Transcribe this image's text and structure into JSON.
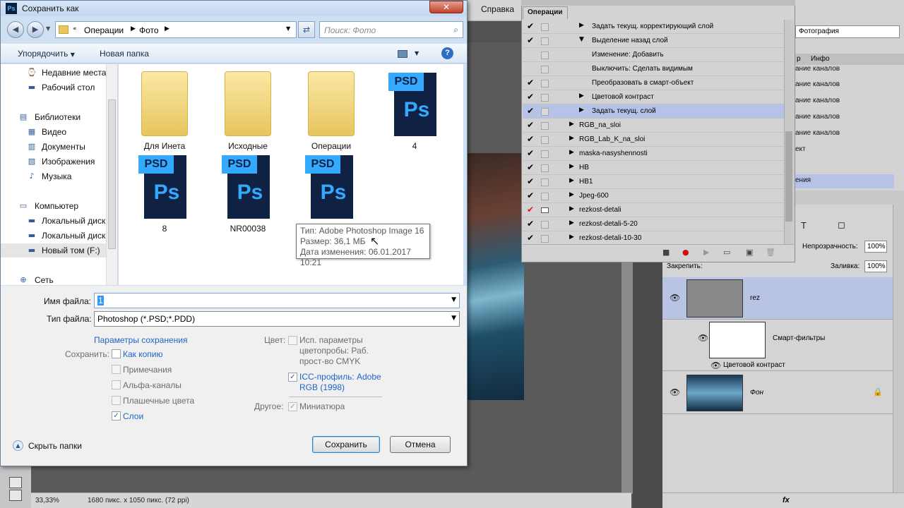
{
  "photoshop": {
    "menu_help": "Справка",
    "window_buttons": [
      "–",
      "❐",
      "✕"
    ],
    "status": {
      "zoom": "33,33%",
      "dimensions": "1680 пикс. x 1050 пикс. (72 ppi)"
    },
    "history_dropdown": "Фотография",
    "info_tabs": [
      "р",
      "Инфо"
    ],
    "history_items": [
      "ание каналов",
      "ание каналов",
      "ание каналов",
      "ание каналов",
      "ание каналов",
      "ект",
      "",
      "ения"
    ],
    "layers": {
      "opacity_label": "Непрозрачность:",
      "opacity_value": "100%",
      "lock_label": "Закрепить:",
      "fill_label": "Заливка:",
      "fill_value": "100%",
      "layer_rez": "rez",
      "smart_filters": "Смарт-фильтры",
      "color_contrast": "Цветовой контраст",
      "layer_fon": "Фон"
    }
  },
  "actions_panel": {
    "tab": "Операции",
    "rows": [
      {
        "label": "Задать текущ. корректирующий слой",
        "indent": 2,
        "tri": "▶",
        "check": "✔"
      },
      {
        "label": "Выделение назад слой",
        "indent": 2,
        "tri": "▼",
        "check": "✔"
      },
      {
        "label": "Изменение: Добавить",
        "indent": 3,
        "tri": "",
        "check": ""
      },
      {
        "label": "Выключить: Сделать видимым",
        "indent": 3,
        "tri": "",
        "check": ""
      },
      {
        "label": "Преобразовать в смарт-объект",
        "indent": 2,
        "tri": "",
        "check": "✔"
      },
      {
        "label": "Цветовой контраст",
        "indent": 2,
        "tri": "▶",
        "check": "✔"
      },
      {
        "label": "Задать текущ. слой",
        "indent": 2,
        "tri": "▶",
        "check": "✔"
      },
      {
        "label": "RGB_na_sloi",
        "indent": 1,
        "tri": "▶",
        "check": "✔"
      },
      {
        "label": "RGB_Lab_K_na_sloi",
        "indent": 1,
        "tri": "▶",
        "check": "✔"
      },
      {
        "label": "maska-nasyshennosti",
        "indent": 1,
        "tri": "▶",
        "check": "✔"
      },
      {
        "label": "HB",
        "indent": 1,
        "tri": "▶",
        "check": "✔"
      },
      {
        "label": "HB1",
        "indent": 1,
        "tri": "▶",
        "check": "✔"
      },
      {
        "label": "Jpeg-600",
        "indent": 1,
        "tri": "▶",
        "check": "✔"
      },
      {
        "label": "rezkost-detali",
        "indent": 1,
        "tri": "▶",
        "check": "✔",
        "check_red": true,
        "box_dialog": true
      },
      {
        "label": "rezkost-detali-5-20",
        "indent": 1,
        "tri": "▶",
        "check": "✔"
      },
      {
        "label": "rezkost-detali-10-30",
        "indent": 1,
        "tri": "▶",
        "check": "✔"
      }
    ],
    "bottom_buttons": [
      "■",
      "●",
      "▶",
      "▭",
      "▣",
      "🗑"
    ]
  },
  "dialog": {
    "title": "Сохранить как",
    "close_glyph": "✕",
    "address": [
      "Операции",
      "Фото"
    ],
    "search_placeholder": "Поиск: Фото",
    "cmd_organize": "Упорядочить",
    "cmd_new_folder": "Новая папка",
    "nav": [
      {
        "label": "Недавние места",
        "icon": "recent-places-icon",
        "glyph": "⌚",
        "indent": 1
      },
      {
        "label": "Рабочий стол",
        "icon": "desktop-icon",
        "glyph": "▬",
        "indent": 1
      },
      {
        "label": "Библиотеки",
        "icon": "libraries-icon",
        "glyph": "▤",
        "indent": 0
      },
      {
        "label": "Видео",
        "icon": "video-icon",
        "glyph": "▦",
        "indent": 1
      },
      {
        "label": "Документы",
        "icon": "documents-icon",
        "glyph": "▥",
        "indent": 1
      },
      {
        "label": "Изображения",
        "icon": "images-icon",
        "glyph": "▧",
        "indent": 1
      },
      {
        "label": "Музыка",
        "icon": "music-icon",
        "glyph": "♪",
        "indent": 1
      },
      {
        "label": "Компьютер",
        "icon": "computer-icon",
        "glyph": "▭",
        "indent": 0
      },
      {
        "label": "Локальный диск",
        "icon": "drive-icon",
        "glyph": "▬",
        "indent": 1
      },
      {
        "label": "Локальный диск",
        "icon": "drive-icon",
        "glyph": "▬",
        "indent": 1
      },
      {
        "label": "Новый том (F:)",
        "icon": "drive-icon",
        "glyph": "▬",
        "indent": 1,
        "selected": true
      },
      {
        "label": "Сеть",
        "icon": "network-icon",
        "glyph": "⊕",
        "indent": 0
      }
    ],
    "files": [
      {
        "name": "Для Инета",
        "kind": "folder"
      },
      {
        "name": "Исходные",
        "kind": "folder"
      },
      {
        "name": "Операции",
        "kind": "folder"
      },
      {
        "name": "4",
        "kind": "psd"
      },
      {
        "name": "8",
        "kind": "psd"
      },
      {
        "name": "NR00038",
        "kind": "psd"
      },
      {
        "name": "",
        "kind": "psd"
      }
    ],
    "psd_tag": "PSD",
    "psd_mark": "Ps",
    "tooltip": {
      "type": "Тип: Adobe Photoshop Image 16",
      "size": "Размер: 36,1 МБ",
      "modified": "Дата изменения: 06.01.2017 10:21"
    },
    "filename_label": "Имя файла:",
    "filename_value": "1",
    "filetype_label": "Тип файла:",
    "filetype_value": "Photoshop (*.PSD;*.PDD)",
    "save_params": "Параметры сохранения",
    "save_label": "Сохранить:",
    "opt_copy": "Как копию",
    "opt_notes": "Примечания",
    "opt_alpha": "Альфа-каналы",
    "opt_spot": "Плашечные цвета",
    "opt_layers": "Слои",
    "color_label": "Цвет:",
    "opt_proof": [
      "Исп. параметры",
      "цветопробы:  Раб.",
      "прост-во CMYK"
    ],
    "opt_icc": [
      "ICC-профиль:  Adobe",
      "RGB (1998)"
    ],
    "other_label": "Другое:",
    "opt_thumb": "Миниатюра",
    "hide_folders": "Скрыть папки",
    "btn_save": "Сохранить",
    "btn_cancel": "Отмена"
  }
}
